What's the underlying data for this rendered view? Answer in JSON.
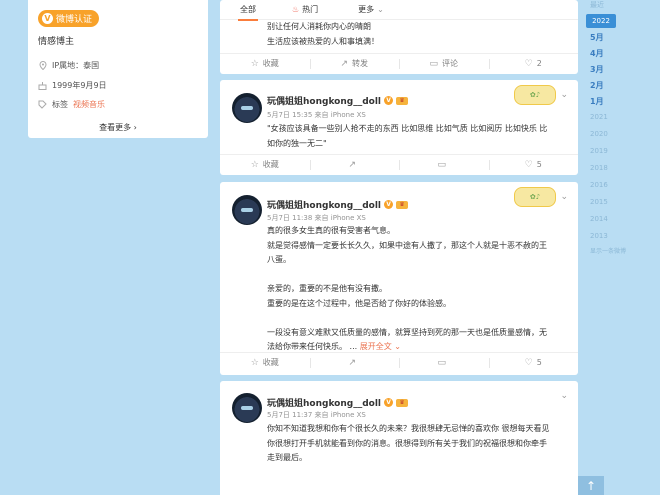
{
  "profile": {
    "badge": "微博认证",
    "role": "情感博主",
    "ip": "IP属地：泰国",
    "birthday": "1999年9月9日",
    "tag_prefix": "标签",
    "tag_value": "视频音乐",
    "view_more": "查看更多"
  },
  "tabs": {
    "all": "全部",
    "hot": "热门",
    "more": "更多"
  },
  "first_post": {
    "lines": [
      "别让任何人消耗你内心的晴朗",
      "生活应该被热爱的人和事填满！"
    ],
    "actions": {
      "fav": "收藏",
      "repost": "转发",
      "comment": "评论",
      "like": "2"
    }
  },
  "posts": [
    {
      "name": "玩偶姐姐hongkong__doll",
      "meta": "5月7日 15:35 来自 iPhone XS",
      "lines": [
        "\"女孩应该具备一些别人抢不走的东西 比如思维 比如气质 比如阅历 比如快乐 比",
        "如你的独一无二\""
      ],
      "actions": {
        "fav": "收藏",
        "repost": "",
        "comment": "",
        "like": "5"
      }
    },
    {
      "name": "玩偶姐姐hongkong__doll",
      "meta": "5月7日 11:38 来自 iPhone XS",
      "lines": [
        "真的很多女生真的很有受害者气息。",
        "就是觉得感情一定要长长久久，如果中途有人撒了，那这个人就是十恶不赦的王",
        "八蛋。",
        "",
        "亲爱的，重要的不是他有没有撒。",
        "重要的是在这个过程中，他是否给了你好的体验感。",
        "",
        "一段没有意义难默又低质量的感情，就算坚持到死的那一天也是低质量感情，无",
        "法给你带来任何快乐。  ..."
      ],
      "expand": "展开全文",
      "actions": {
        "fav": "收藏",
        "repost": "",
        "comment": "",
        "like": "5"
      }
    },
    {
      "name": "玩偶姐姐hongkong__doll",
      "meta": "5月7日 11:37 来自 iPhone XS",
      "lines": [
        "你知不知道我想和你有个很长久的未来？我很想肆无忌惮的喜欢你 很想每天看见",
        "你很想打开手机就能看到你的消息。很想得到所有关于我们的祝福很想和你牵手",
        "走到最后。"
      ]
    }
  ],
  "timeline": {
    "top": "最近",
    "selected_year": "2022",
    "months": [
      "5月",
      "4月",
      "3月",
      "2月",
      "1月"
    ],
    "years": [
      "2021",
      "2020",
      "2019",
      "2018",
      "2016",
      "2015",
      "2014",
      "2013"
    ],
    "back": "显示一条微博"
  },
  "back_to_top": "↑",
  "colors": {
    "accent": "#fa7d3c",
    "link": "#eb7350",
    "timeline": "#3a8fd6",
    "background": "#b9ddf3"
  }
}
